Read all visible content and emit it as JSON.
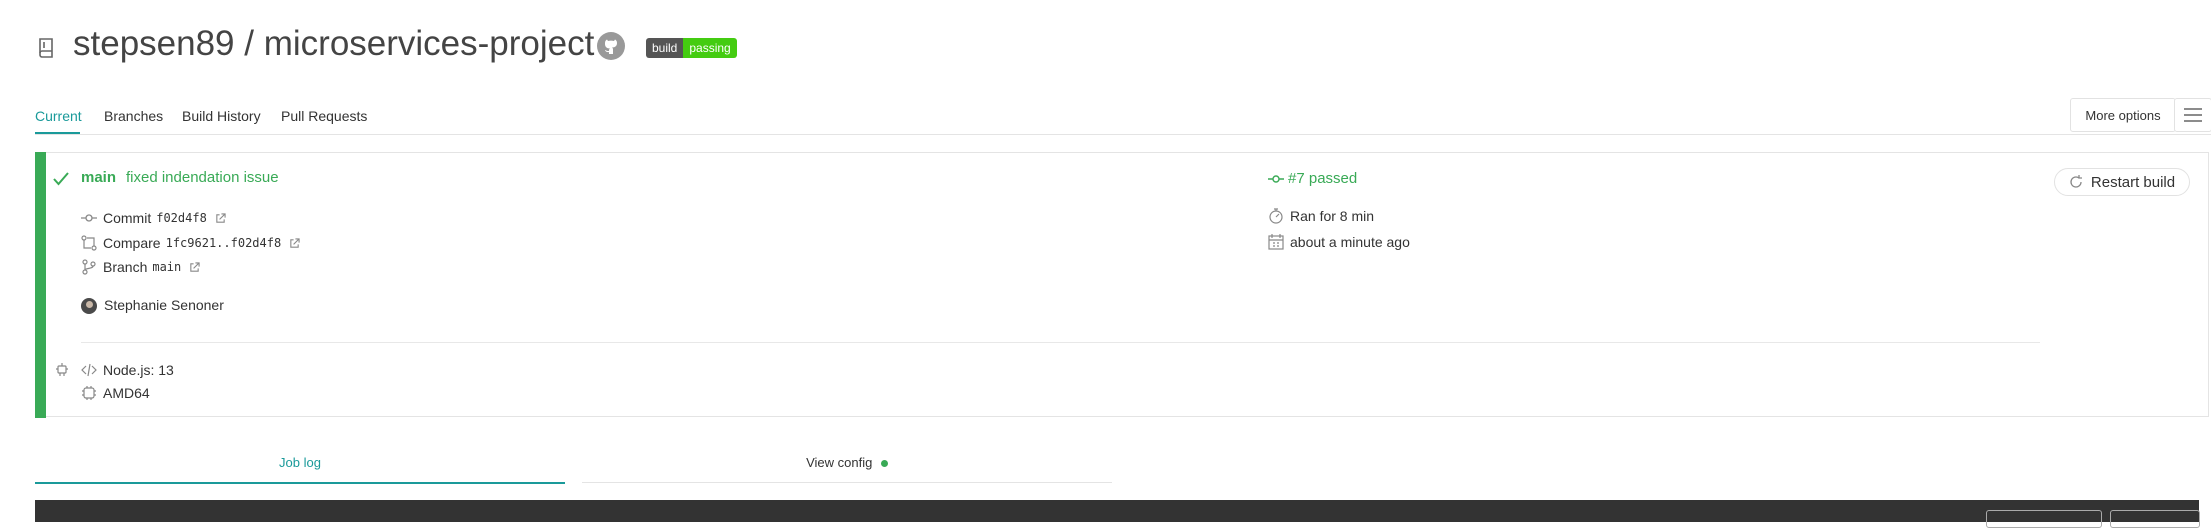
{
  "header": {
    "repo_icon": "repo-book-icon",
    "owner": "stepsen89",
    "separator": "/",
    "repo_name": "microservices-project",
    "github_icon": "github-icon",
    "badge": {
      "left": "build",
      "right": "passing",
      "left_color": "#555555",
      "right_color": "#44cc11"
    }
  },
  "tabs": [
    {
      "label": "Current",
      "active": true
    },
    {
      "label": "Branches"
    },
    {
      "label": "Build History"
    },
    {
      "label": "Pull Requests"
    }
  ],
  "more_options": {
    "label": "More options",
    "icon": "hamburger-icon"
  },
  "build": {
    "status_color": "#39aa56",
    "status_icon": "check-icon",
    "branch": "main",
    "message": "fixed indendation issue",
    "commit_label": "Commit",
    "commit_sha": "f02d4f8",
    "compare_label": "Compare",
    "compare_range": "1fc9621..f02d4f8",
    "branch_label": "Branch",
    "branch_name": "main",
    "author": "Stephanie Senoner",
    "number_status": "#7 passed",
    "duration": "Ran for 8 min",
    "finished": "about a minute ago",
    "restart_label": "Restart build",
    "language": "Node.js: 13",
    "arch": "AMD64"
  },
  "log_tabs": {
    "job_log": "Job log",
    "view_config": "View config"
  }
}
